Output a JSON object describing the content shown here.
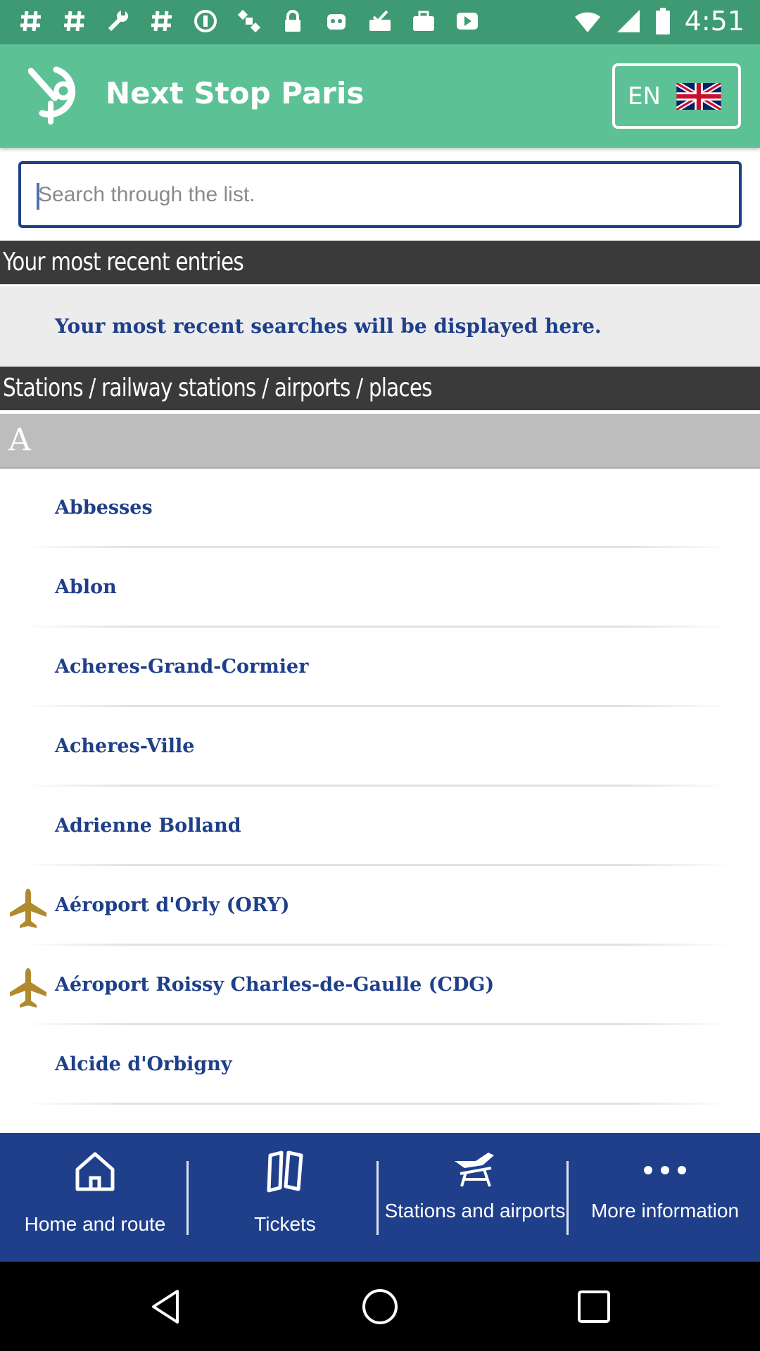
{
  "status_bar": {
    "time": "4:51",
    "icons": [
      "hashtag-icon",
      "hashtag-icon",
      "wrench-icon",
      "hashtag-icon",
      "block-icon",
      "satellite-icon",
      "lock-icon",
      "robot-icon",
      "check-tray-icon",
      "work-bag-icon",
      "play-icon",
      "wifi-icon",
      "signal-icon",
      "battery-icon"
    ]
  },
  "header": {
    "title": "Next Stop Paris",
    "language_code": "EN"
  },
  "search": {
    "placeholder": "Search through the list."
  },
  "recent": {
    "heading": "Your most recent entries",
    "empty_message": "Your most recent searches will be displayed here."
  },
  "stations": {
    "heading": "Stations / railway stations / airports / places",
    "letter": "A",
    "items": [
      {
        "label": "Abbesses",
        "icon": ""
      },
      {
        "label": "Ablon",
        "icon": ""
      },
      {
        "label": "Acheres-Grand-Cormier",
        "icon": ""
      },
      {
        "label": "Acheres-Ville",
        "icon": ""
      },
      {
        "label": "Adrienne Bolland",
        "icon": ""
      },
      {
        "label": "Aéroport d'Orly (ORY)",
        "icon": "airplane-icon"
      },
      {
        "label": "Aéroport Roissy Charles-de-Gaulle (CDG)",
        "icon": "airplane-icon"
      },
      {
        "label": "Alcide d'Orbigny",
        "icon": ""
      }
    ]
  },
  "bottom_nav": {
    "items": [
      {
        "label": "Home and route",
        "icon": "home-icon"
      },
      {
        "label": "Tickets",
        "icon": "ticket-icon"
      },
      {
        "label": "Stations and airports",
        "icon": "train-plane-icon"
      },
      {
        "label": "More information",
        "icon": "more-dots-icon"
      }
    ]
  },
  "colors": {
    "status_bar": "#3e9a72",
    "header": "#5cc295",
    "accent": "#1f3f8a",
    "section_header": "#3a3a3a",
    "plane": "#b08a2c"
  }
}
